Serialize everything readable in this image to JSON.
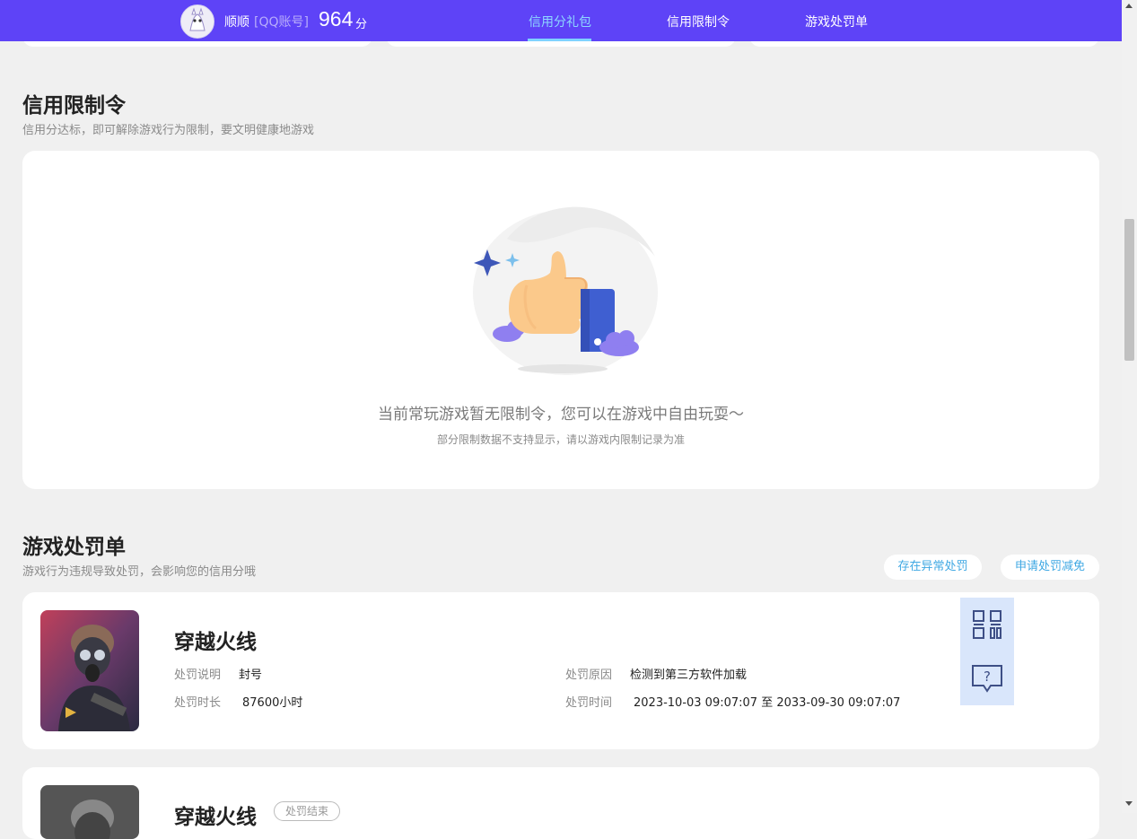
{
  "header": {
    "user_name": "顺顺",
    "account_type": "[QQ账号]",
    "score": "964",
    "score_unit": "分",
    "tabs": [
      {
        "label": "信用分礼包",
        "active": true
      },
      {
        "label": "信用限制令",
        "active": false
      },
      {
        "label": "游戏处罚单",
        "active": false
      }
    ]
  },
  "restriction": {
    "title": "信用限制令",
    "subtitle": "信用分达标，即可解除游戏行为限制，要文明健康地游戏",
    "empty_message": "当前常玩游戏暂无限制令，您可以在游戏中自由玩耍～",
    "empty_note": "部分限制数据不支持显示，请以游戏内限制记录为准"
  },
  "penalty": {
    "title": "游戏处罚单",
    "subtitle": "游戏行为违规导致处罚，会影响您的信用分哦",
    "abnormal_button": "存在异常处罚",
    "appeal_button": "申请处罚减免",
    "records": [
      {
        "game": "穿越火线",
        "desc_label": "处罚说明",
        "desc_value": "封号",
        "duration_label": "处罚时长",
        "duration_value": "87600小时",
        "reason_label": "处罚原因",
        "reason_value": "检测到第三方软件加载",
        "time_label": "处罚时间",
        "time_value": "2023-10-03 09:07:07 至 2033-09-30 09:07:07"
      },
      {
        "game": "穿越火线",
        "status": "处罚结束"
      }
    ]
  },
  "colors": {
    "header_bg": "#5e43f7",
    "active_tab": "#8ed8ff",
    "link_blue": "#3fa8e3",
    "float_btn_bg": "#d9e6fb"
  },
  "icons": [
    "qrcode-icon",
    "help-chat-icon",
    "thumbs-up-illustration"
  ]
}
